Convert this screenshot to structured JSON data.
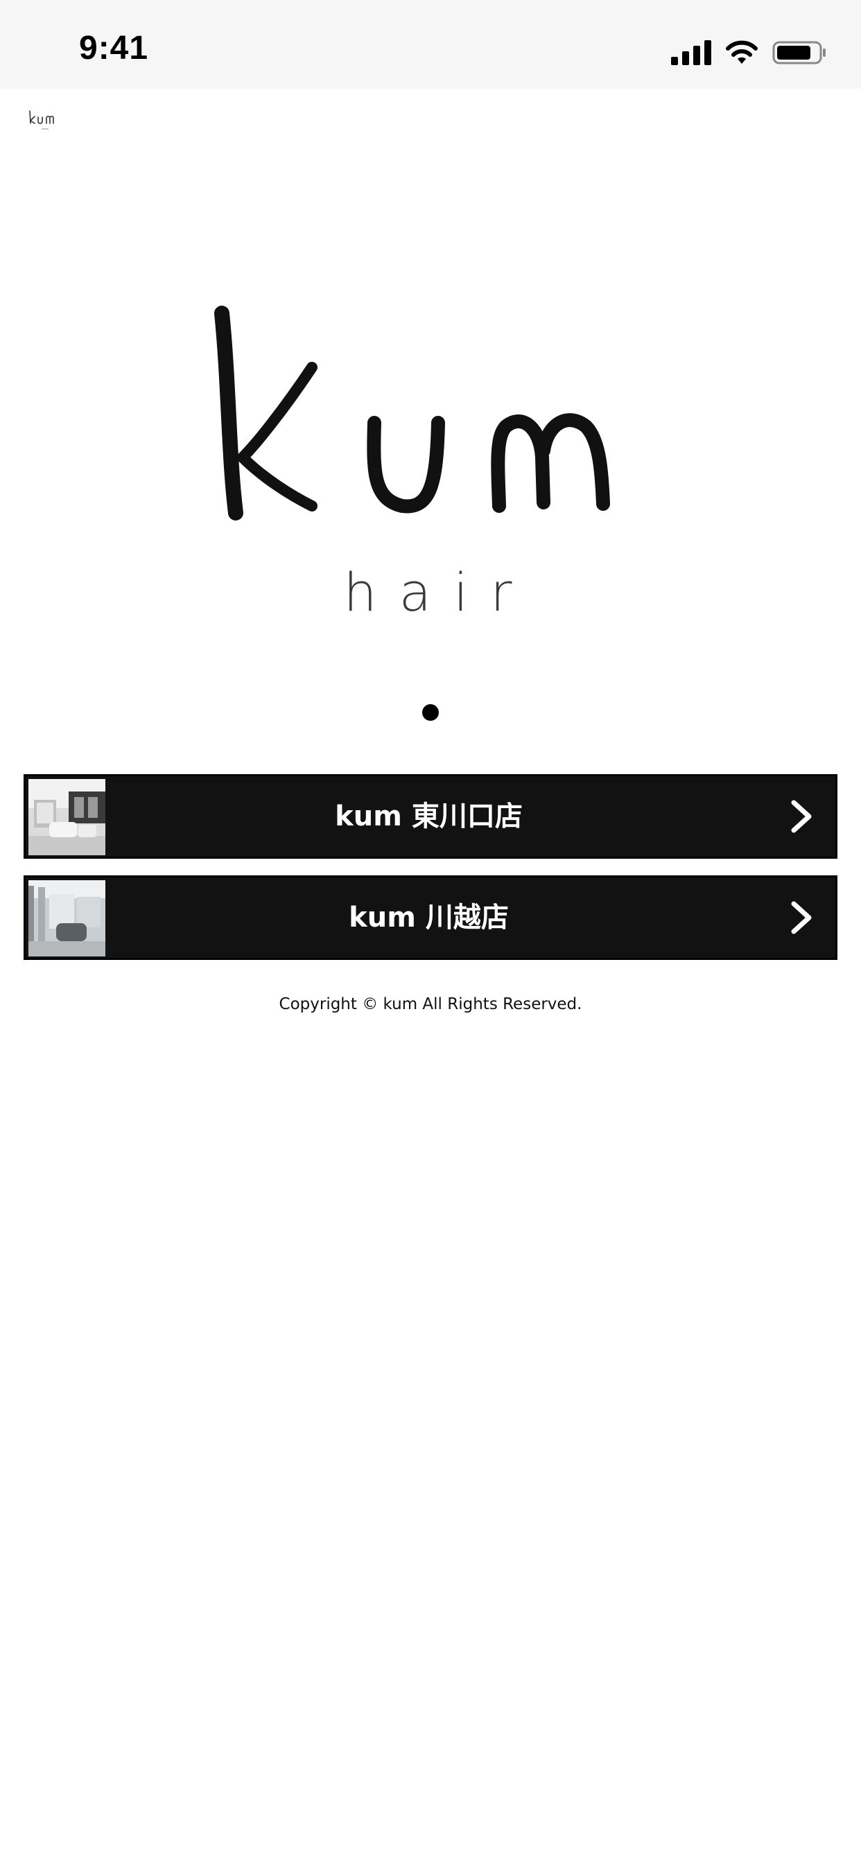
{
  "status_bar": {
    "time": "9:41",
    "icons": [
      "cellular-signal-icon",
      "wifi-icon",
      "battery-icon"
    ]
  },
  "header": {
    "logo_icon": "kum-hair-logo-small"
  },
  "hero": {
    "logo_icon": "kum-hair-logo",
    "subtitle": "hair",
    "pager_count": 1,
    "pager_active": 1
  },
  "stores": [
    {
      "label": "kum 東川口店",
      "thumbnail_icon": "salon-interior-photo",
      "arrow_icon": "chevron-right-icon"
    },
    {
      "label": "kum 川越店",
      "thumbnail_icon": "salon-interior-photo",
      "arrow_icon": "chevron-right-icon"
    }
  ],
  "footer": {
    "copyright": "Copyright © kum All Rights Reserved."
  },
  "colors": {
    "status_bar_bg": "#f6f6f6",
    "button_bg": "#121212",
    "button_text": "#ffffff",
    "page_bg": "#ffffff"
  }
}
